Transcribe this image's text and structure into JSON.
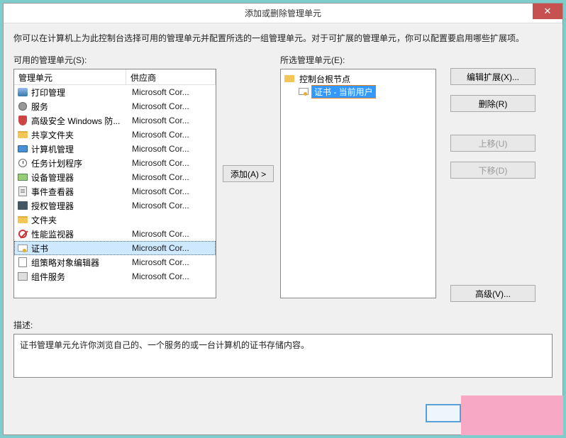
{
  "window": {
    "title": "添加或删除管理单元"
  },
  "intro": "你可以在计算机上为此控制台选择可用的管理单元并配置所选的一组管理单元。对于可扩展的管理单元，你可以配置要启用哪些扩展项。",
  "available": {
    "label": "可用的管理单元(S):",
    "columns": {
      "name": "管理单元",
      "vendor": "供应商"
    },
    "items": [
      {
        "name": "打印管理",
        "vendor": "Microsoft Cor...",
        "icon": "i-printer"
      },
      {
        "name": "服务",
        "vendor": "Microsoft Cor...",
        "icon": "i-gear"
      },
      {
        "name": "高级安全 Windows 防...",
        "vendor": "Microsoft Cor...",
        "icon": "i-shield"
      },
      {
        "name": "共享文件夹",
        "vendor": "Microsoft Cor...",
        "icon": "i-folder"
      },
      {
        "name": "计算机管理",
        "vendor": "Microsoft Cor...",
        "icon": "i-monitor"
      },
      {
        "name": "任务计划程序",
        "vendor": "Microsoft Cor...",
        "icon": "i-clock"
      },
      {
        "name": "设备管理器",
        "vendor": "Microsoft Cor...",
        "icon": "i-device"
      },
      {
        "name": "事件查看器",
        "vendor": "Microsoft Cor...",
        "icon": "i-event"
      },
      {
        "name": "授权管理器",
        "vendor": "Microsoft Cor...",
        "icon": "i-auth"
      },
      {
        "name": "文件夹",
        "vendor": "",
        "icon": "i-folder"
      },
      {
        "name": "性能监视器",
        "vendor": "Microsoft Cor...",
        "icon": "i-nope"
      },
      {
        "name": "证书",
        "vendor": "Microsoft Cor...",
        "icon": "i-cert",
        "selected": true
      },
      {
        "name": "组策略对象编辑器",
        "vendor": "Microsoft Cor...",
        "icon": "i-policy"
      },
      {
        "name": "组件服务",
        "vendor": "Microsoft Cor...",
        "icon": "i-comp"
      }
    ]
  },
  "add_button": "添加(A) >",
  "selected": {
    "label": "所选管理单元(E):",
    "root": "控制台根节点",
    "child": "证书 - 当前用户"
  },
  "buttons": {
    "edit_ext": "编辑扩展(X)...",
    "remove": "删除(R)",
    "move_up": "上移(U)",
    "move_down": "下移(D)",
    "advanced": "高级(V)..."
  },
  "description": {
    "label": "描述:",
    "text": "证书管理单元允许你浏览自己的、一个服务的或一台计算机的证书存储内容。"
  }
}
